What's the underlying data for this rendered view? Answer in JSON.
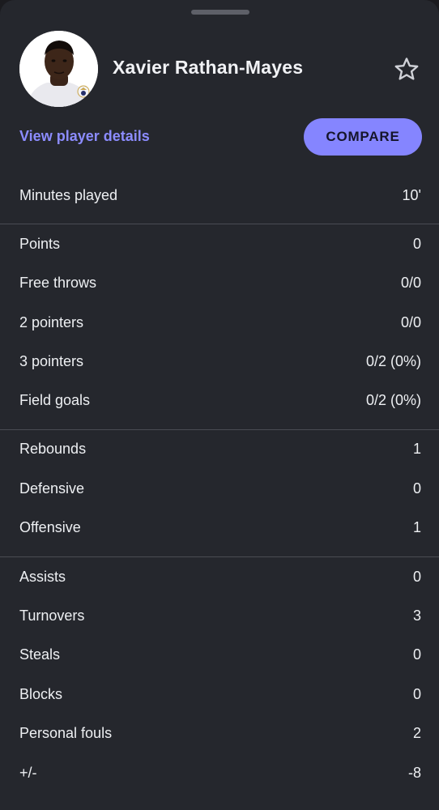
{
  "player": {
    "name": "Xavier Rathan-Mayes",
    "avatar_alt": "player photo",
    "club_badge_text": "Baloncesto"
  },
  "actions": {
    "details_link": "View player details",
    "compare_label": "COMPARE"
  },
  "icons": {
    "favorite": "star-outline-icon"
  },
  "colors": {
    "background": "#25272d",
    "accent": "#8585ff",
    "link": "#8c8cff"
  },
  "stats": {
    "minutes": {
      "label": "Minutes played",
      "value": "10'"
    },
    "scoring": [
      {
        "label": "Points",
        "value": "0"
      },
      {
        "label": "Free throws",
        "value": "0/0"
      },
      {
        "label": "2 pointers",
        "value": "0/0"
      },
      {
        "label": "3 pointers",
        "value": "0/2 (0%)"
      },
      {
        "label": "Field goals",
        "value": "0/2 (0%)"
      }
    ],
    "rebounding": [
      {
        "label": "Rebounds",
        "value": "1"
      },
      {
        "label": "Defensive",
        "value": "0"
      },
      {
        "label": "Offensive",
        "value": "1"
      }
    ],
    "other": [
      {
        "label": "Assists",
        "value": "0"
      },
      {
        "label": "Turnovers",
        "value": "3"
      },
      {
        "label": "Steals",
        "value": "0"
      },
      {
        "label": "Blocks",
        "value": "0"
      },
      {
        "label": "Personal fouls",
        "value": "2"
      },
      {
        "label": "+/-",
        "value": "-8"
      }
    ]
  }
}
